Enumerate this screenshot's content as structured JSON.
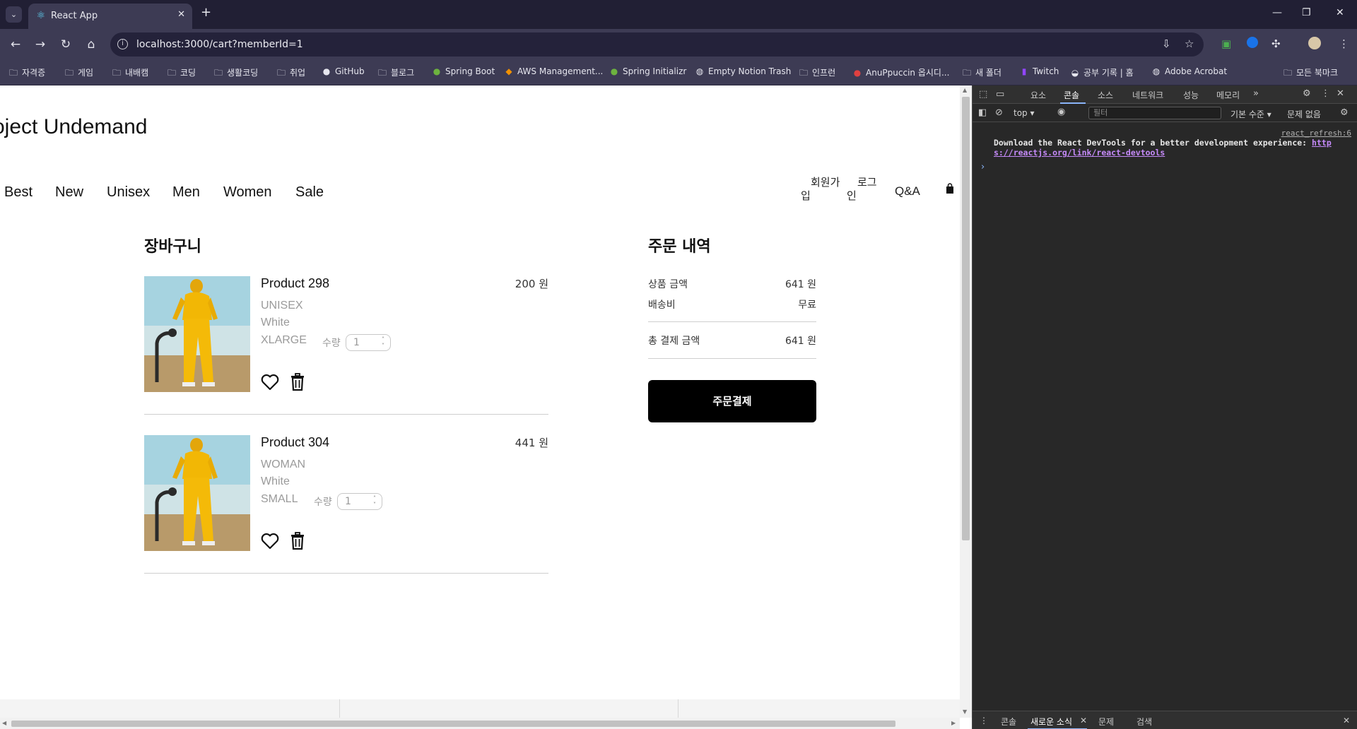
{
  "browser": {
    "tab_title": "React App",
    "url": "localhost:3000/cart?memberId=1",
    "bookmarks": [
      "자격증",
      "게임",
      "내배캠",
      "코딩",
      "생활코딩",
      "취업",
      "GitHub",
      "블로그",
      "Spring Boot",
      "AWS Management...",
      "Spring Initializr",
      "Empty Notion Trash",
      "인프런",
      "AnuPpuccin 옵시디...",
      "새 폴더",
      "Twitch",
      "공부 기록 | 홈",
      "Adobe Acrobat"
    ],
    "all_bookmarks": "모든 북마크"
  },
  "site": {
    "title": "oject Undemand",
    "nav": [
      "Best",
      "New",
      "Unisex",
      "Men",
      "Women",
      "Sale"
    ],
    "signup_line1": "회원가",
    "signup_line2": "입",
    "login_line1": "로그",
    "login_line2": "인",
    "qa": "Q&A"
  },
  "cart": {
    "title": "장바구니",
    "qty_label": "수량",
    "items": [
      {
        "name": "Product 298",
        "price": "200 원",
        "category": "UNISEX",
        "color": "White",
        "size": "XLARGE",
        "qty": "1"
      },
      {
        "name": "Product 304",
        "price": "441 원",
        "category": "WOMAN",
        "color": "White",
        "size": "SMALL",
        "qty": "1"
      }
    ]
  },
  "summary": {
    "title": "주문 내역",
    "subtotal_label": "상품 금액",
    "subtotal_value": "641 원",
    "shipping_label": "배송비",
    "shipping_value": "무료",
    "total_label": "총 결제 금액",
    "total_value": "641 원",
    "checkout_label": "주문결제"
  },
  "devtools": {
    "tabs": [
      "요소",
      "콘솔",
      "소스",
      "네트워크",
      "성능",
      "메모리"
    ],
    "active_tab": "콘솔",
    "context": "top",
    "filter_placeholder": "필터",
    "levels": "기본 수준",
    "issues": "문제 없음",
    "source_link": "react_refresh:6",
    "message_text": "Download the React DevTools for a better development experience: ",
    "message_link_1": "http",
    "message_link_2": "s://reactjs.org/link/react-devtools",
    "drawer_tabs": [
      "콘솔",
      "새로운 소식",
      "문제",
      "검색"
    ]
  }
}
